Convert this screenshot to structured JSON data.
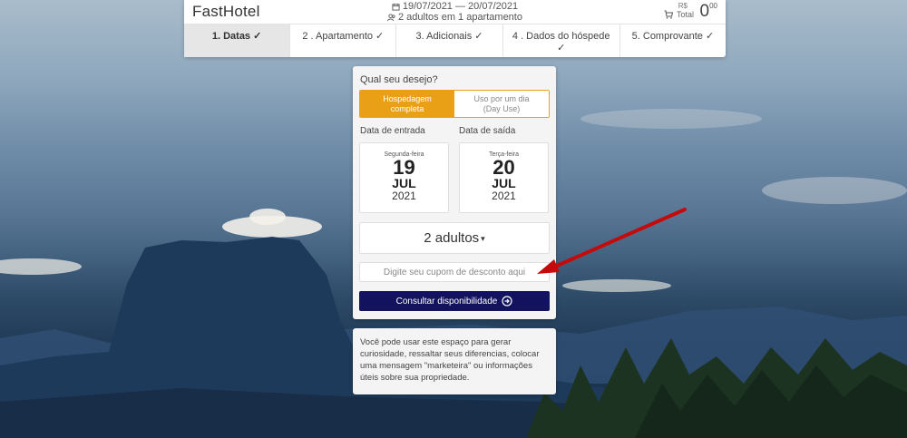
{
  "header": {
    "brand": "FastHotel",
    "dates": "19/07/2021 — 20/07/2021",
    "occupancy": "2 adultos em 1 apartamento",
    "currency": "R$",
    "total_label": "Total",
    "total_value": "0",
    "total_cents": "00"
  },
  "steps": [
    {
      "label": "1. Datas ✓"
    },
    {
      "label": "2 .  Apartamento ✓"
    },
    {
      "label": "3. Adicionais ✓"
    },
    {
      "label": "4 .  Dados do hóspede ✓"
    },
    {
      "label": "5. Comprovante ✓"
    }
  ],
  "booking": {
    "question": "Qual seu desejo?",
    "option_full": "Hospedagem completa",
    "option_day": "Uso por um dia (Day Use)",
    "checkin_label": "Data de entrada",
    "checkout_label": "Data de saída",
    "checkin": {
      "weekday": "Segunda-feira",
      "day": "19",
      "month": "JUL",
      "year": "2021"
    },
    "checkout": {
      "weekday": "Terça-feira",
      "day": "20",
      "month": "JUL",
      "year": "2021"
    },
    "guests": "2 adultos",
    "coupon_placeholder": "Digite seu cupom de desconto aqui",
    "consult_label": "Consultar disponibilidade"
  },
  "info": {
    "text": "Você pode usar este espaço para gerar curiosidade, ressaltar seus diferencias, colocar uma mensagem \"marketeira\" ou informações úteis sobre sua propriedade."
  },
  "colors": {
    "accent": "#eaa016",
    "primary_button": "#12125e",
    "annotation_arrow": "#c40a0a"
  }
}
